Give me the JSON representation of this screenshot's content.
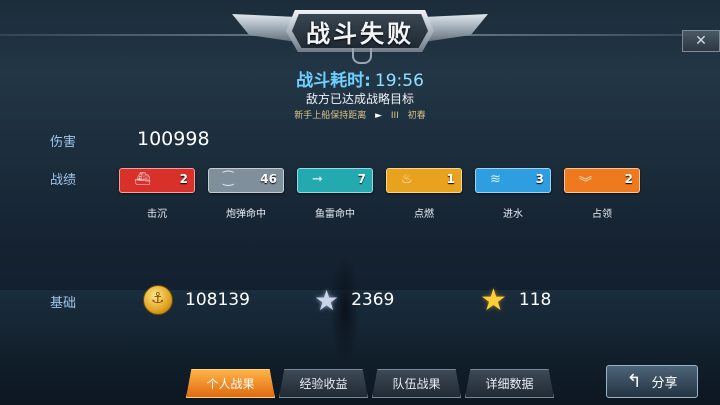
{
  "header": {
    "title": "战斗失败",
    "close_glyph": "✕"
  },
  "battle": {
    "time_label": "战斗耗时:",
    "time_value": "19:56",
    "reason": "敌方已达成战略目标",
    "tip_text": "新手上船保持距离",
    "tip_arrow": "►",
    "tip_mid": "III",
    "tip_name": "初春"
  },
  "damage": {
    "label": "伤害",
    "value": "100998"
  },
  "record": {
    "label": "战绩",
    "items": [
      {
        "caption": "击沉",
        "count": "2",
        "icon": "sunk-ship-icon",
        "color": "#d8312a"
      },
      {
        "caption": "炮弹命中",
        "count": "46",
        "icon": "shell-icon",
        "color": "#7f8f9c"
      },
      {
        "caption": "鱼雷命中",
        "count": "7",
        "icon": "torpedo-icon",
        "color": "#23a9b0"
      },
      {
        "caption": "点燃",
        "count": "1",
        "icon": "fire-icon",
        "color": "#e9a21d"
      },
      {
        "caption": "进水",
        "count": "3",
        "icon": "flood-icon",
        "color": "#2f9ee0"
      },
      {
        "caption": "占领",
        "count": "2",
        "icon": "capture-chevron-icon",
        "color": "#ef7a1e"
      }
    ]
  },
  "base": {
    "label": "基础",
    "coins": "108139",
    "silver_xp": "2369",
    "gold_xp": "118"
  },
  "tabs": [
    {
      "label": "个人战果",
      "active": true
    },
    {
      "label": "经验收益",
      "active": false
    },
    {
      "label": "队伍战果",
      "active": false
    },
    {
      "label": "详细数据",
      "active": false
    }
  ],
  "share": {
    "label": "分享",
    "icon": "return-arrow-icon"
  }
}
